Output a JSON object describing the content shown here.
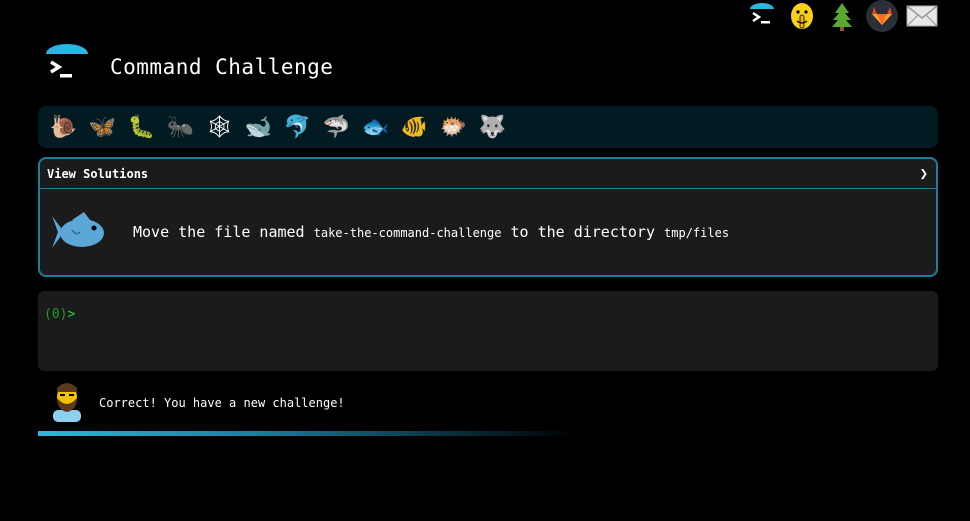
{
  "header": {
    "title": "Command Challenge"
  },
  "top_icons": [
    "command-challenge-icon",
    "shushing-face-icon",
    "tree-icon",
    "gitlab-icon",
    "envelope-icon"
  ],
  "levels": [
    {
      "icon": "snail-icon",
      "glyph": "🐌"
    },
    {
      "icon": "butterfly-icon",
      "glyph": "🦋"
    },
    {
      "icon": "caterpillar-icon",
      "glyph": "🐛"
    },
    {
      "icon": "ant-icon",
      "glyph": "🐜"
    },
    {
      "icon": "spider-web-icon",
      "glyph": "🕸"
    },
    {
      "icon": "whale-icon",
      "glyph": "🐋"
    },
    {
      "icon": "dolphin-icon",
      "glyph": "🐬"
    },
    {
      "icon": "shark-icon",
      "glyph": "🦈"
    },
    {
      "icon": "fish-icon",
      "glyph": "🐟"
    },
    {
      "icon": "tropical-fish-icon",
      "glyph": "🐠"
    },
    {
      "icon": "blowfish-icon",
      "glyph": "🐡"
    },
    {
      "icon": "wolf-icon",
      "glyph": "🐺"
    }
  ],
  "challenge": {
    "view_solutions": "View Solutions",
    "chevron": "❯",
    "instruction_part1": "Move the file named ",
    "file_name": "take-the-command-challenge",
    "instruction_part2": " to the directory ",
    "dir_name": "tmp/files"
  },
  "terminal": {
    "prompt_code": "(0)",
    "prompt_arrow": ">"
  },
  "status": {
    "message": "Correct! You have a new challenge!"
  },
  "colors": {
    "accent": "#1b7e9c",
    "panel": "#1b1b1b",
    "level_bar": "#021a21",
    "prompt": "#1f9e1f",
    "progress": "#33b5d8"
  }
}
